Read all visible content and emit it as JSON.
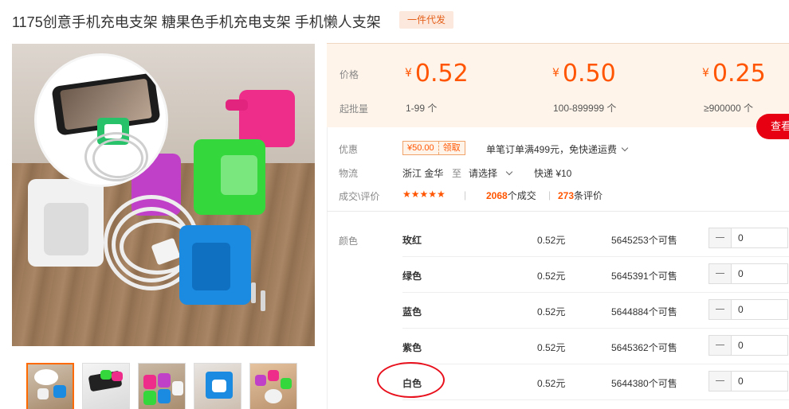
{
  "header": {
    "title": "1175创意手机充电支架 糖果色手机充电支架 手机懒人支架",
    "badge": "一件代发"
  },
  "gallery": {
    "main_image": "product-photo",
    "thumbnail_count": 5,
    "active_thumbnail": 1
  },
  "pricing": {
    "price_label": "价格",
    "moq_label": "起批量",
    "currency": "¥",
    "tiers": [
      {
        "price": "0.52",
        "range": "1-99 个"
      },
      {
        "price": "0.50",
        "range": "100-899999 个"
      },
      {
        "price": "0.25",
        "range": "≥900000 个"
      }
    ],
    "check_button": "查看"
  },
  "promo": {
    "label": "优惠",
    "coupon_amount": "¥50.00",
    "coupon_action": "领取",
    "free_shipping": "单笔订单满499元，免快递运费"
  },
  "logistics": {
    "label": "物流",
    "origin": "浙江 金华",
    "to_word": "至",
    "destination": "请选择",
    "shipping": "快递 ¥10"
  },
  "transactions": {
    "label": "成交\\评价",
    "stars": "★★★★★",
    "deals_count": "2068",
    "deals_suffix": "个成交",
    "reviews_count": "273",
    "reviews_suffix": "条评价"
  },
  "sku": {
    "label": "颜色",
    "rows": [
      {
        "name": "玫红",
        "price": "0.52元",
        "stock": "5645253个可售",
        "qty": "0"
      },
      {
        "name": "绿色",
        "price": "0.52元",
        "stock": "5645391个可售",
        "qty": "0"
      },
      {
        "name": "蓝色",
        "price": "0.52元",
        "stock": "5644884个可售",
        "qty": "0"
      },
      {
        "name": "紫色",
        "price": "0.52元",
        "stock": "5645362个可售",
        "qty": "0"
      },
      {
        "name": "白色",
        "price": "0.52元",
        "stock": "5644380个可售",
        "qty": "0"
      }
    ],
    "highlighted_row": "白色"
  },
  "colors": {
    "accent": "#ff5500",
    "price_bg": "#fff4ea",
    "button_red": "#e60012",
    "annotation": "#e8101c"
  }
}
